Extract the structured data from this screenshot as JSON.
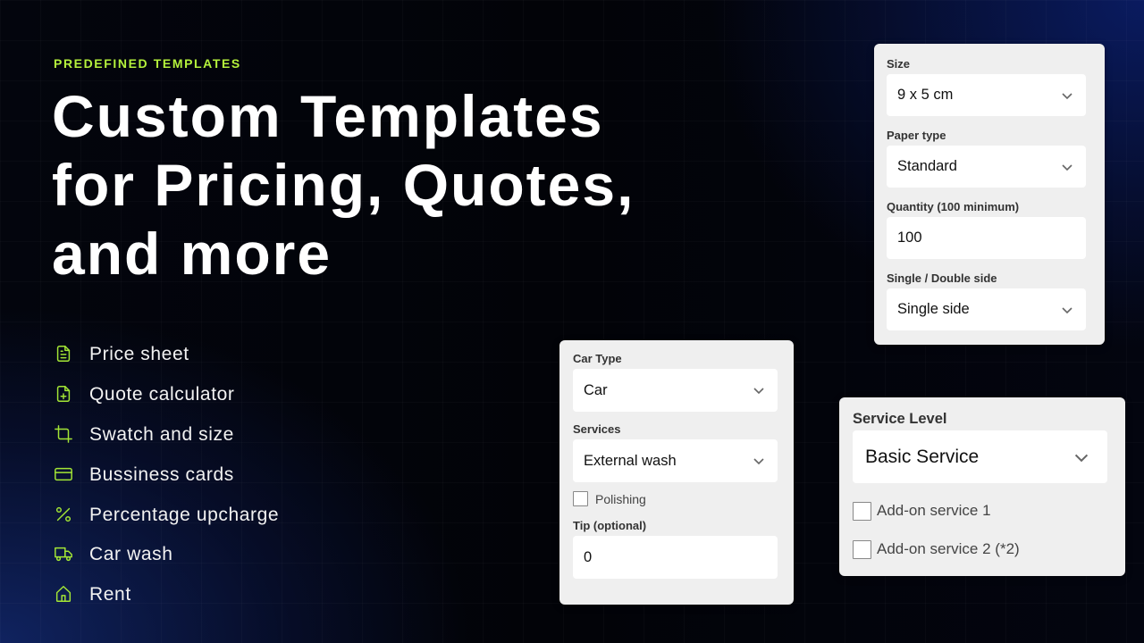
{
  "eyebrow": "PREDEFINED TEMPLATES",
  "headline": {
    "lines": [
      "Custom Templates",
      "for Pricing, Quotes,",
      "and more"
    ]
  },
  "accent_color": "#a3e635",
  "features": [
    {
      "icon": "file-text-icon",
      "label": "Price sheet"
    },
    {
      "icon": "file-plus-icon",
      "label": "Quote calculator"
    },
    {
      "icon": "crop-icon",
      "label": "Swatch and size"
    },
    {
      "icon": "credit-card-icon",
      "label": "Bussiness cards"
    },
    {
      "icon": "percent-icon",
      "label": "Percentage upcharge"
    },
    {
      "icon": "truck-icon",
      "label": "Car wash"
    },
    {
      "icon": "home-icon",
      "label": "Rent"
    }
  ],
  "print_form": {
    "size": {
      "label": "Size",
      "value": "9 x 5 cm"
    },
    "paper_type": {
      "label": "Paper type",
      "value": "Standard"
    },
    "quantity": {
      "label": "Quantity (100 minimum)",
      "value": "100"
    },
    "sides": {
      "label": "Single / Double side",
      "value": "Single side"
    }
  },
  "car_form": {
    "car_type": {
      "label": "Car Type",
      "value": "Car"
    },
    "services": {
      "label": "Services",
      "value": "External wash"
    },
    "polishing": {
      "label": "Polishing",
      "checked": false
    },
    "tip": {
      "label": "Tip (optional)",
      "value": "0"
    }
  },
  "service_form": {
    "service_level": {
      "label": "Service Level",
      "value": "Basic Service"
    },
    "addons": [
      {
        "label": "Add-on service 1",
        "checked": false
      },
      {
        "label": "Add-on service 2 (*2)",
        "checked": false
      }
    ]
  }
}
